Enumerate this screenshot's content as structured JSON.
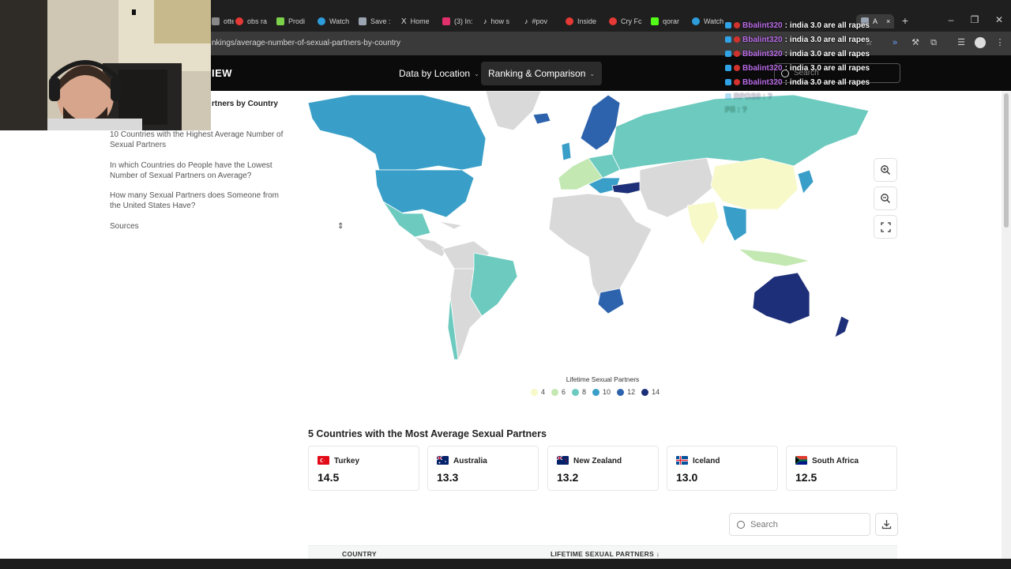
{
  "browser": {
    "tabs": [
      {
        "label": "otte",
        "color": "#888888"
      },
      {
        "label": "obs ra",
        "color": "#e53935"
      },
      {
        "label": "Prodi",
        "color": "#7cd14a"
      },
      {
        "label": "Watch",
        "color": "#2d9cdb"
      },
      {
        "label": "Save :",
        "color": "#9aa4b2"
      },
      {
        "label": "Home",
        "color": "#dddddd"
      },
      {
        "label": "(3) In:",
        "color": "#e1306c"
      },
      {
        "label": "how s",
        "color": "#ffffff"
      },
      {
        "label": "#pov",
        "color": "#ffffff"
      },
      {
        "label": "Inside",
        "color": "#e53935"
      },
      {
        "label": "Cry Fc",
        "color": "#e53935"
      },
      {
        "label": "qorar",
        "color": "#53fc18"
      },
      {
        "label": "Watch",
        "color": "#2d9cdb"
      }
    ],
    "active_tab": {
      "label": "A",
      "close": "×"
    },
    "new_tab": "+",
    "window_controls": [
      "–",
      "❐",
      "✕"
    ],
    "url": "nkings/average-number-of-sexual-partners-by-country"
  },
  "site": {
    "logo_fragment": "IEW",
    "nav": [
      {
        "label": "Data by Location"
      },
      {
        "label": "Ranking & Comparison"
      }
    ],
    "search_placeholder": "Search"
  },
  "sidebar": {
    "title_fragment": "rtners by Country",
    "links": [
      "10 Countries with the Highest Average Number of Sexual Partners",
      "In which Countries do People have the Lowest Number of Sexual Partners on Average?",
      "How many Sexual Partners does Someone from the United States Have?",
      "Sources"
    ]
  },
  "map": {
    "legend_title": "Lifetime Sexual Partners",
    "legend": [
      {
        "label": "4",
        "color": "#f7f9c9"
      },
      {
        "label": "6",
        "color": "#c3e8b2"
      },
      {
        "label": "8",
        "color": "#6ccabf"
      },
      {
        "label": "10",
        "color": "#3a9fc8"
      },
      {
        "label": "12",
        "color": "#2d63ad"
      },
      {
        "label": "14",
        "color": "#1d2f78"
      }
    ],
    "controls": [
      "zoom-in",
      "zoom-out",
      "fullscreen"
    ]
  },
  "top5": {
    "title": "5 Countries with the Most Average Sexual Partners",
    "cards": [
      {
        "country": "Turkey",
        "value": "14.5"
      },
      {
        "country": "Australia",
        "value": "13.3"
      },
      {
        "country": "New Zealand",
        "value": "13.2"
      },
      {
        "country": "Iceland",
        "value": "13.0"
      },
      {
        "country": "South Africa",
        "value": "12.5"
      }
    ]
  },
  "table": {
    "search_placeholder": "Search",
    "columns": [
      "COUNTRY",
      "LIFETIME SEXUAL PARTNERS ↓"
    ]
  },
  "chat": {
    "lines": [
      {
        "user": "Bbalint320",
        "sep": ":",
        "message": "india 3.0 are all rapes"
      },
      {
        "user": "Bbalint320",
        "sep": ":",
        "message": "india 3.0 are all rapes"
      },
      {
        "user": "Bbalint320",
        "sep": ":",
        "message": "india 3.0 are all rapes"
      },
      {
        "user": "Bbalint320",
        "sep": ":",
        "message": "india 3.0 are all rapes"
      },
      {
        "user": "Bbalint320",
        "sep": ":",
        "message": "india 3.0 are all rapes"
      }
    ],
    "faded_1": "RPGS0 : ?",
    "faded_2": "Pfi : ?"
  }
}
